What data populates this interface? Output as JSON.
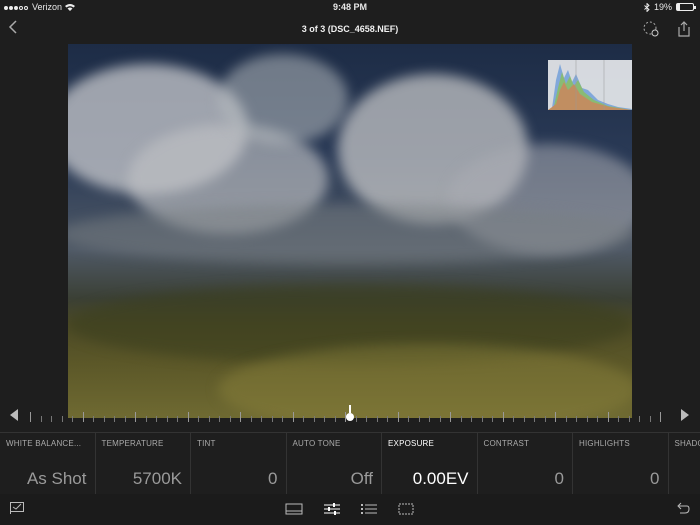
{
  "status": {
    "carrier": "Verizon",
    "time": "9:48 PM",
    "battery": "19%"
  },
  "nav": {
    "title": "3 of 3 (DSC_4658.NEF)"
  },
  "adjustments": [
    {
      "label": "WHITE BALANCE...",
      "value": "As Shot"
    },
    {
      "label": "TEMPERATURE",
      "value": "5700K"
    },
    {
      "label": "TINT",
      "value": "0"
    },
    {
      "label": "AUTO TONE",
      "value": "Off"
    },
    {
      "label": "EXPOSURE",
      "value": "0.00EV",
      "active": true
    },
    {
      "label": "CONTRAST",
      "value": "0"
    },
    {
      "label": "HIGHLIGHTS",
      "value": "0"
    },
    {
      "label": "SHADO",
      "value": ""
    }
  ],
  "icons": {
    "back": "chevron-left-icon",
    "crop_rotate": "dashed-circle-icon",
    "share": "share-icon",
    "flag": "flag-icon",
    "filmstrip": "filmstrip-icon",
    "sliders": "sliders-icon",
    "presets": "list-icon",
    "crop": "crop-icon",
    "undo": "undo-icon"
  }
}
